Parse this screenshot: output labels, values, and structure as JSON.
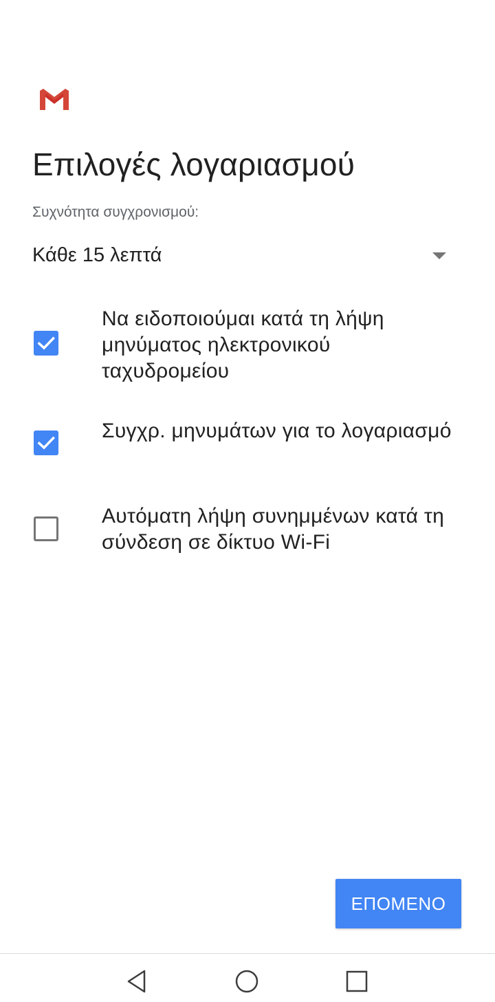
{
  "app": {
    "logo_icon": "gmail-icon",
    "title": "Επιλογές λογαριασμού"
  },
  "sync": {
    "label": "Συχνότητα συγχρονισμού:",
    "selected": "Κάθε 15 λεπτά",
    "arrow_icon": "dropdown-arrow-icon"
  },
  "options": [
    {
      "label": "Να ειδοποιούμαι κατά τη λήψη μηνύματος ηλεκτρονικού ταχυδρομείου",
      "checked": true
    },
    {
      "label": "Συγχρ. μηνυμάτων για το λογαριασμό",
      "checked": true
    },
    {
      "label": "Αυτόματη λήψη συνημμένων κατά τη σύνδεση σε δίκτυο Wi-Fi",
      "checked": false
    }
  ],
  "next_button": {
    "label": "ΕΠΟΜΕΝΟ"
  },
  "colors": {
    "accent": "#4285f4",
    "gmail_red": "#d44638",
    "text_primary": "#212121",
    "text_secondary": "#5f6368"
  },
  "navbar": {
    "back_icon": "back-triangle-icon",
    "home_icon": "home-circle-icon",
    "recents_icon": "recents-square-icon"
  }
}
